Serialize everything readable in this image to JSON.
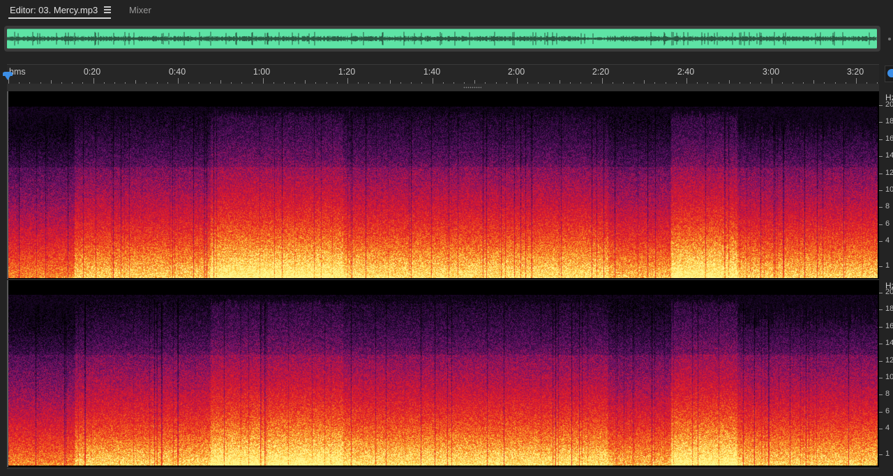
{
  "tabs": {
    "editor_label": "Editor: 03. Mercy.mp3",
    "mixer_label": "Mixer"
  },
  "ruler": {
    "unit_label": "hms",
    "labels": [
      "0:20",
      "0:40",
      "1:00",
      "1:20",
      "1:40",
      "2:00",
      "2:20",
      "2:40",
      "3:00",
      "3:20"
    ]
  },
  "frequency_scale": {
    "unit_label": "Hz",
    "visible_ticks": [
      "20",
      "18",
      "16",
      "14",
      "12",
      "10",
      "8",
      "6",
      "4",
      "1"
    ]
  },
  "colors": {
    "overview_waveform": "#5ee3a5",
    "playhead": "#3c8ee6",
    "spectrogram_low": "#000000",
    "spectrogram_mid": "#e0182a",
    "spectrogram_high": "#ffe56a"
  },
  "icons": {
    "tab_menu": "hamburger-menu-icon",
    "playhead": "playhead-marker-icon",
    "panel_button": "zoom-lock-icon"
  }
}
